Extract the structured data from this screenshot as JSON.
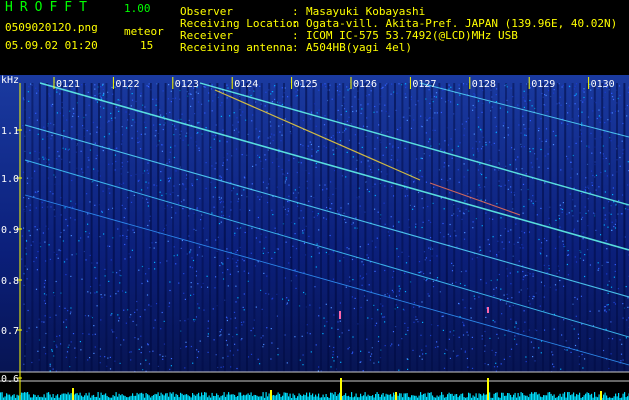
{
  "header": {
    "app_title": "HROFFT",
    "app_version": "1.00",
    "file_name": "050902012O.png",
    "date_time": "05.09.02 01:20",
    "meteor_label": "meteor",
    "meteor_count": "15",
    "info": [
      {
        "label": "Observer",
        "sep": ":",
        "value": "Masayuki Kobayashi"
      },
      {
        "label": "Receiving Location",
        "sep": ":",
        "value": "Ogata-vill. Akita-Pref. JAPAN (139.96E, 40.02N)"
      },
      {
        "label": "Receiver",
        "sep": ":",
        "value": "ICOM IC-575 53.7492(@LCD)MHz USB"
      },
      {
        "label": "Receiving antenna",
        "sep": ":",
        "value": "A504HB(yagi 4el)"
      }
    ]
  },
  "spectrogram": {
    "y_unit": "kHz",
    "y_ticks": [
      "1.1",
      "1.0",
      "0.9",
      "0.8",
      "0.7",
      "0.6"
    ],
    "time_labels": [
      "0121",
      "0122",
      "0123",
      "0124",
      "0125",
      "0126",
      "0127",
      "0128",
      "0129",
      "0130"
    ],
    "colors": {
      "background": "#0a1a70",
      "speckle": "#3b6cff",
      "trace": "#66ffee",
      "axis": "#ffff00",
      "baseline": "#00ffff"
    }
  }
}
